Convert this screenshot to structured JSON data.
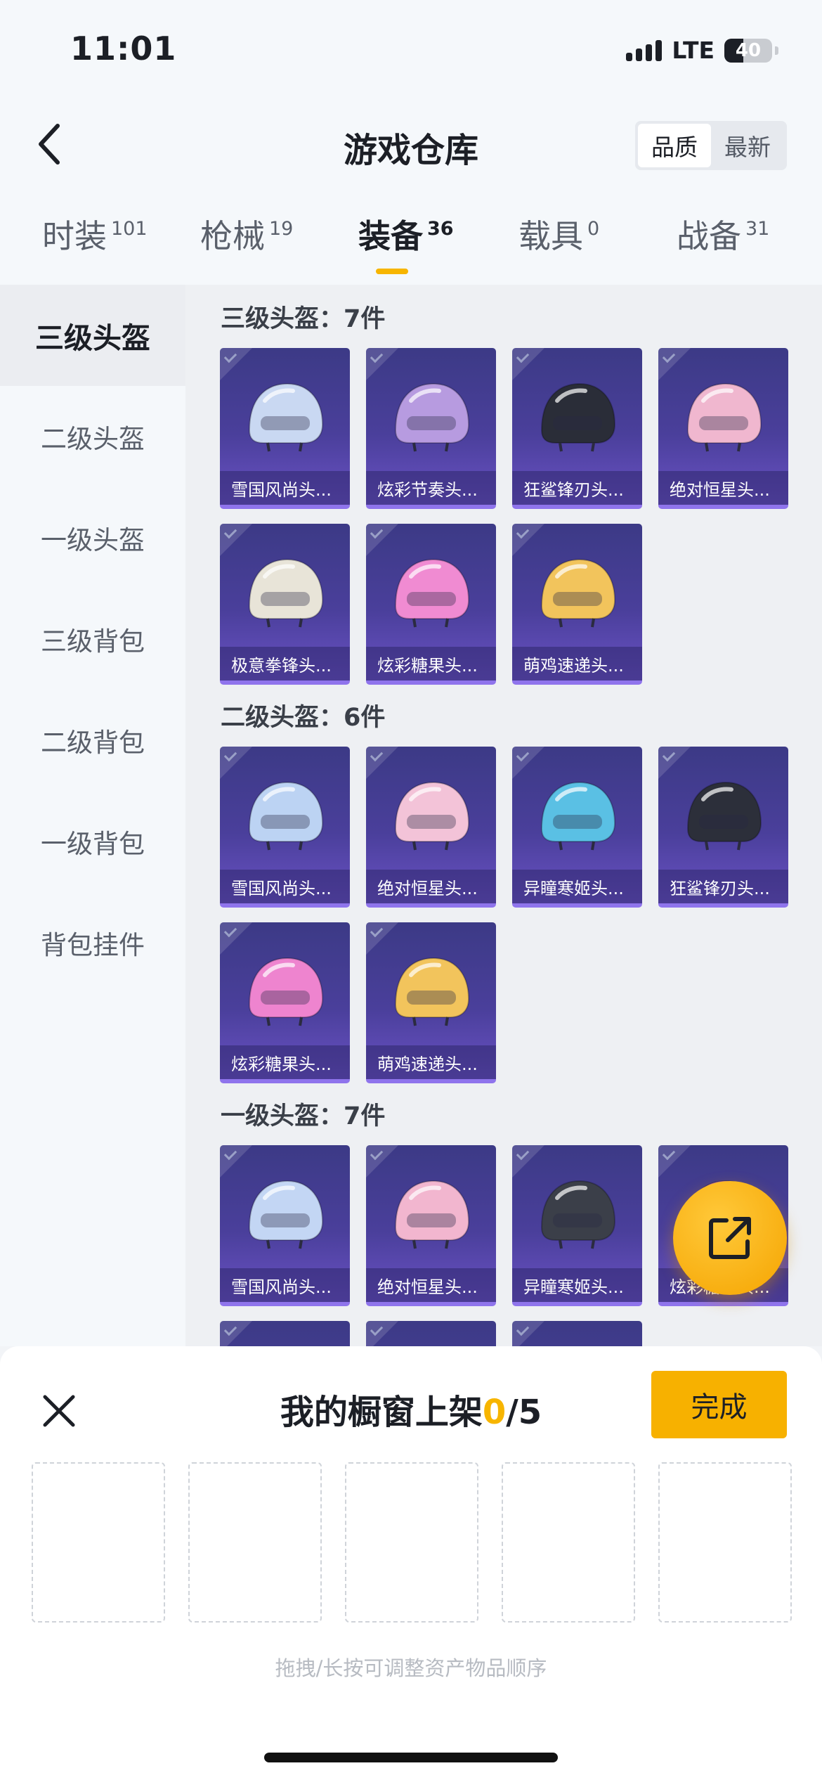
{
  "status_bar": {
    "time": "11:01",
    "network": "LTE",
    "battery": "40",
    "battery_level_percent": 40
  },
  "header": {
    "title": "游戏仓库",
    "sort_options": [
      "品质",
      "最新"
    ],
    "sort_selected": "品质"
  },
  "tabs": [
    {
      "label": "时装",
      "count": "101"
    },
    {
      "label": "枪械",
      "count": "19"
    },
    {
      "label": "装备",
      "count": "36",
      "active": true
    },
    {
      "label": "载具",
      "count": "0"
    },
    {
      "label": "战备",
      "count": "31"
    }
  ],
  "sidebar": [
    {
      "label": "三级头盔",
      "active": true
    },
    {
      "label": "二级头盔"
    },
    {
      "label": "一级头盔"
    },
    {
      "label": "三级背包"
    },
    {
      "label": "二级背包"
    },
    {
      "label": "一级背包"
    },
    {
      "label": "背包挂件"
    }
  ],
  "sections": [
    {
      "title": "三级头盔：7件",
      "items": [
        {
          "name": "雪国风尚头...",
          "color": "#c9d8f2"
        },
        {
          "name": "炫彩节奏头...",
          "color": "#b79be0"
        },
        {
          "name": "狂鲨锋刃头...",
          "color": "#2a2d38"
        },
        {
          "name": "绝对恒星头...",
          "color": "#f0b7cf"
        },
        {
          "name": "极意拳锋头...",
          "color": "#e8e4d8"
        },
        {
          "name": "炫彩糖果头...",
          "color": "#f08bd2"
        },
        {
          "name": "萌鸡速递头...",
          "color": "#f2c45c"
        }
      ]
    },
    {
      "title": "二级头盔：6件",
      "items": [
        {
          "name": "雪国风尚头...",
          "color": "#bcd3f3"
        },
        {
          "name": "绝对恒星头...",
          "color": "#f3c3d8"
        },
        {
          "name": "异瞳寒姬头...",
          "color": "#5ac0e4"
        },
        {
          "name": "狂鲨锋刃头...",
          "color": "#2c2f3a"
        },
        {
          "name": "炫彩糖果头...",
          "color": "#ee84cf"
        },
        {
          "name": "萌鸡速递头...",
          "color": "#f2c45c"
        }
      ]
    },
    {
      "title": "一级头盔：7件",
      "items": [
        {
          "name": "雪国风尚头...",
          "color": "#c3d6f4"
        },
        {
          "name": "绝对恒星头...",
          "color": "#f2b6cf"
        },
        {
          "name": "异瞳寒姬头...",
          "color": "#3b3f49"
        },
        {
          "name": "炫彩糖果头...",
          "color": "#ee84cf"
        },
        {
          "name": "",
          "color": "#c9d8f2"
        },
        {
          "name": "",
          "color": "#f0b7cf"
        },
        {
          "name": "",
          "color": "#5ac0e4"
        }
      ]
    }
  ],
  "showcase": {
    "title": "我的橱窗上架",
    "count": "0",
    "total": "/5",
    "done_label": "完成",
    "slots": 5,
    "hint": "拖拽/长按可调整资产物品顺序"
  },
  "colors": {
    "accent": "#f7b500",
    "card": "#4a3f9b",
    "card_border": "#8f74ec"
  },
  "icons": {
    "back": "chevron-left-icon",
    "share": "share-out-icon",
    "close": "close-icon"
  }
}
